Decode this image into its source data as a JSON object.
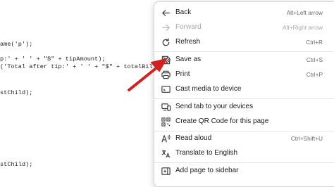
{
  "code": {
    "lines": [
      "ame('p');",
      "p:' + ' ' + \"$\" + tipAmount);",
      "('Total after tip:' + ' ' + \"$\" + totalBill);",
      "stChild);",
      "stChild);"
    ]
  },
  "menu": {
    "items": [
      {
        "label": "Back",
        "shortcut": "Alt+Left arrow",
        "icon": "back-arrow-icon"
      },
      {
        "label": "Forward",
        "shortcut": "Alt+Right arrow",
        "icon": "forward-arrow-icon"
      },
      {
        "label": "Refresh",
        "shortcut": "Ctrl+R",
        "icon": "refresh-icon"
      },
      {
        "label": "Save as",
        "shortcut": "Ctrl+S",
        "icon": "save-as-icon"
      },
      {
        "label": "Print",
        "shortcut": "Ctrl+P",
        "icon": "printer-icon"
      },
      {
        "label": "Cast media to device",
        "shortcut": "",
        "icon": "cast-icon"
      },
      {
        "label": "Send tab to your devices",
        "shortcut": "",
        "icon": "devices-icon"
      },
      {
        "label": "Create QR Code for this page",
        "shortcut": "",
        "icon": "qr-code-icon"
      },
      {
        "label": "Read aloud",
        "shortcut": "Ctrl+Shift+U",
        "icon": "read-aloud-icon"
      },
      {
        "label": "Translate to English",
        "shortcut": "",
        "icon": "translate-icon"
      },
      {
        "label": "Add page to sidebar",
        "shortcut": "",
        "icon": "sidebar-add-icon"
      }
    ]
  },
  "colors": {
    "arrow": "#d32020",
    "menu_border": "#d4d4d4",
    "disabled_text": "#a8a8a8"
  }
}
